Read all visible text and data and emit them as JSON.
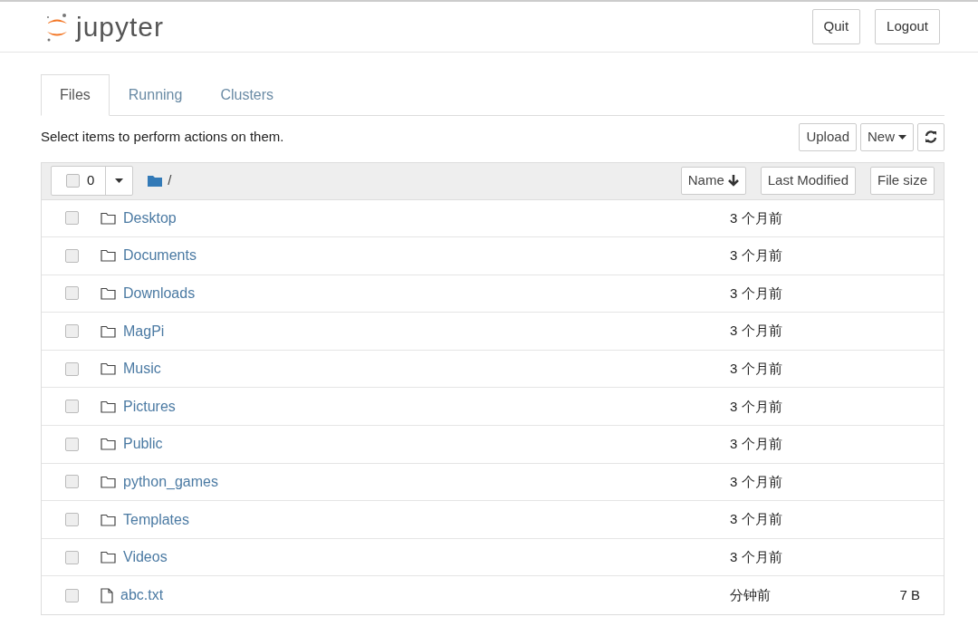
{
  "header": {
    "logo_text": "jupyter",
    "buttons": [
      "Quit",
      "Logout"
    ]
  },
  "tabs": [
    {
      "label": "Files",
      "selected": true
    },
    {
      "label": "Running",
      "selected": false
    },
    {
      "label": "Clusters",
      "selected": false
    }
  ],
  "toolbar": {
    "hint": "Select items to perform actions on them.",
    "buttons": [
      "Upload",
      "New"
    ]
  },
  "list_header": {
    "select_all": {
      "checked": false,
      "count": "0"
    },
    "path": "/",
    "sort_buttons": [
      "Name",
      "Last Modified",
      "File size"
    ]
  },
  "files": [
    {
      "kind": "folder",
      "name": "Desktop",
      "modified": "3 个月前",
      "checked": false
    },
    {
      "kind": "folder",
      "name": "Documents",
      "modified": "3 个月前",
      "checked": false
    },
    {
      "kind": "folder",
      "name": "Downloads",
      "modified": "3 个月前",
      "checked": false
    },
    {
      "kind": "folder",
      "name": "MagPi",
      "modified": "3 个月前",
      "checked": false
    },
    {
      "kind": "folder",
      "name": "Music",
      "modified": "3 个月前",
      "checked": false
    },
    {
      "kind": "folder",
      "name": "Pictures",
      "modified": "3 个月前",
      "checked": false
    },
    {
      "kind": "folder",
      "name": "Public",
      "modified": "3 个月前",
      "checked": false
    },
    {
      "kind": "folder",
      "name": "python_games",
      "modified": "3 个月前",
      "checked": false
    },
    {
      "kind": "folder",
      "name": "Templates",
      "modified": "3 个月前",
      "checked": false
    },
    {
      "kind": "folder",
      "name": "Videos",
      "modified": "3 个月前",
      "checked": false
    },
    {
      "kind": "file",
      "name": "abc.txt",
      "modified": "分钟前",
      "size": "7 B",
      "checked": false
    }
  ]
}
